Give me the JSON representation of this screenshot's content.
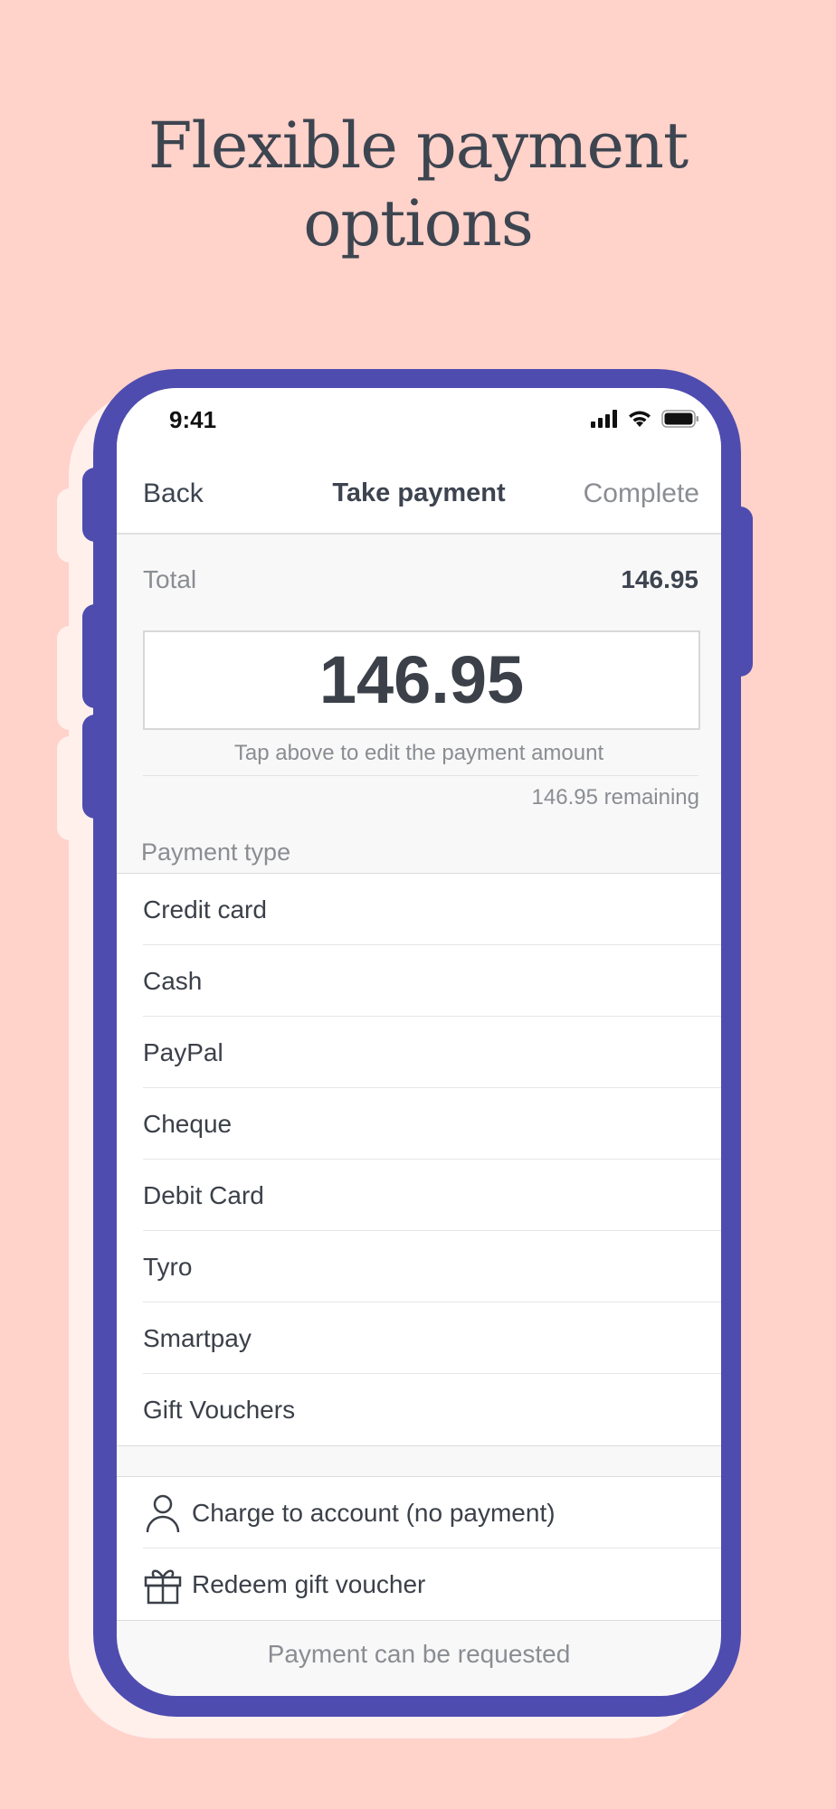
{
  "headline": {
    "line1": "Flexible payment",
    "line2": "options"
  },
  "colors": {
    "background": "#ffd2ca",
    "phone_frame": "#4f4cb0",
    "text_dark": "#3b4049",
    "text_muted": "#8a8d92"
  },
  "status_bar": {
    "time": "9:41",
    "icons": [
      "cellular-signal-icon",
      "wifi-icon",
      "battery-icon"
    ]
  },
  "nav": {
    "back_label": "Back",
    "title": "Take payment",
    "complete_label": "Complete"
  },
  "total": {
    "label": "Total",
    "value": "146.95"
  },
  "amount": {
    "value": "146.95",
    "hint": "Tap above to edit the payment amount",
    "remaining": "146.95 remaining"
  },
  "payment_types": {
    "section_label": "Payment type",
    "items": [
      "Credit card",
      "Cash",
      "PayPal",
      "Cheque",
      "Debit Card",
      "Tyro",
      "Smartpay",
      "Gift Vouchers"
    ]
  },
  "actions": [
    {
      "icon": "person-icon",
      "label": "Charge to account (no payment)"
    },
    {
      "icon": "gift-icon",
      "label": "Redeem gift voucher"
    }
  ],
  "footer_note": "Payment can be requested"
}
